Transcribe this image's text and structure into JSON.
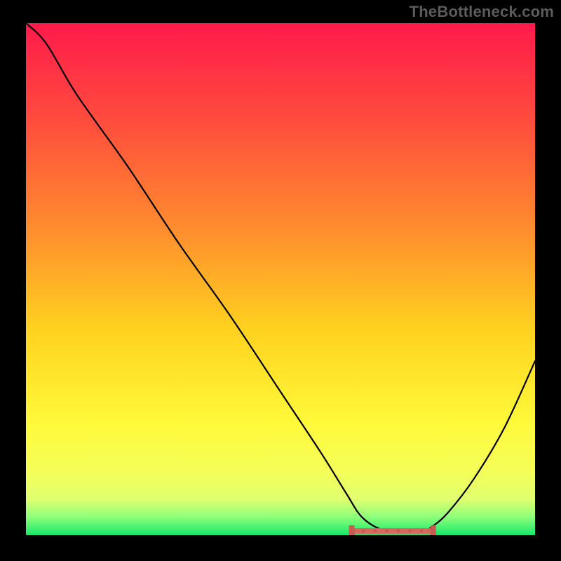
{
  "watermark": "TheBottleneck.com",
  "chart_data": {
    "type": "line",
    "title": "",
    "xlabel": "",
    "ylabel": "",
    "xlim": [
      0,
      100
    ],
    "ylim": [
      0,
      100
    ],
    "gradient_stops": [
      {
        "pos": 0.0,
        "color": "#ff1a4b"
      },
      {
        "pos": 0.2,
        "color": "#ff4f3d"
      },
      {
        "pos": 0.4,
        "color": "#ff8c2e"
      },
      {
        "pos": 0.6,
        "color": "#ffd21f"
      },
      {
        "pos": 0.78,
        "color": "#fff93a"
      },
      {
        "pos": 0.88,
        "color": "#f4ff5a"
      },
      {
        "pos": 0.93,
        "color": "#e0ff70"
      },
      {
        "pos": 0.965,
        "color": "#8dff7a"
      },
      {
        "pos": 1.0,
        "color": "#17e86a"
      }
    ],
    "series": [
      {
        "name": "bottleneck-curve",
        "x": [
          0,
          4,
          10,
          20,
          30,
          40,
          50,
          58,
          63,
          66,
          70,
          74,
          78,
          80,
          83,
          88,
          94,
          100
        ],
        "y": [
          100,
          96,
          86,
          72,
          57,
          43,
          28,
          16,
          8,
          3.5,
          1.0,
          0.6,
          0.8,
          1.8,
          4.5,
          11,
          21,
          34
        ]
      }
    ],
    "optimal_band": {
      "x_start": 64,
      "x_end": 80,
      "y": 0.8,
      "color": "#d46a60",
      "dot_color": "#c95a52"
    },
    "colors": {
      "curve": "#000000",
      "frame_bg": "#000000"
    }
  }
}
